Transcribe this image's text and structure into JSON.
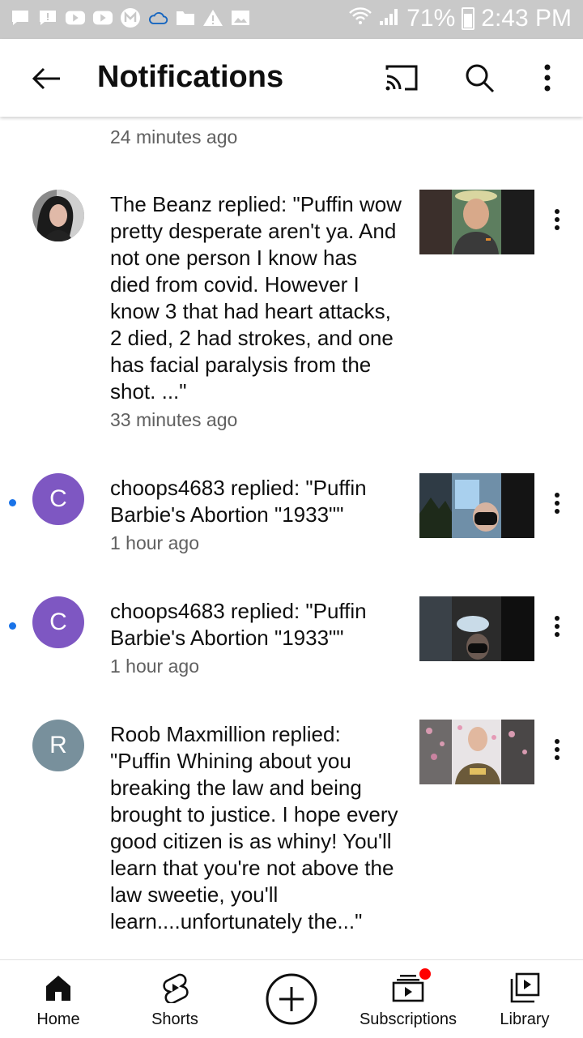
{
  "status_bar": {
    "icons": [
      "chat-bubble-icon",
      "alert-chat-icon",
      "youtube-icon",
      "youtube-icon",
      "m-icon",
      "cloud-icon",
      "folder-icon",
      "warning-icon",
      "image-icon"
    ],
    "battery": "71%",
    "time": "2:43 PM"
  },
  "header": {
    "title": "Notifications",
    "icons": [
      "back-arrow-icon",
      "cast-icon",
      "search-icon",
      "more-vertical-icon"
    ]
  },
  "notifications": {
    "top_time": "24 minutes ago",
    "items": [
      {
        "avatar_letter": "",
        "avatar_color": "#5a5a5a",
        "unread": false,
        "text": "The Beanz replied: \"Puffin wow pretty desperate aren't ya. And not one person I know has died from covid. However I know 3 that had heart attacks, 2 died, 2 had strokes, and one has facial paralysis from the shot. ...\"",
        "time": "33 minutes ago"
      },
      {
        "avatar_letter": "C",
        "avatar_color": "#7e57c2",
        "unread": true,
        "text": "choops4683 replied: \"Puffin Barbie's Abortion \"1933\"\"",
        "time": "1 hour ago"
      },
      {
        "avatar_letter": "C",
        "avatar_color": "#7e57c2",
        "unread": true,
        "text": "choops4683 replied: \"Puffin Barbie's Abortion \"1933\"\"",
        "time": "1 hour ago"
      },
      {
        "avatar_letter": "R",
        "avatar_color": "#78909c",
        "unread": false,
        "text": "Roob Maxmillion replied: \"Puffin Whining about you breaking the law and being brought to justice. I hope every good citizen is as whiny! You'll learn that you're not above the law sweetie, you'll learn....unfortunately the...\"",
        "time": ""
      }
    ]
  },
  "bottom_nav": {
    "home": "Home",
    "shorts": "Shorts",
    "subscriptions": "Subscriptions",
    "library": "Library"
  },
  "colors": {
    "unread_dot": "#1a73e8",
    "badge": "#ff0000"
  }
}
